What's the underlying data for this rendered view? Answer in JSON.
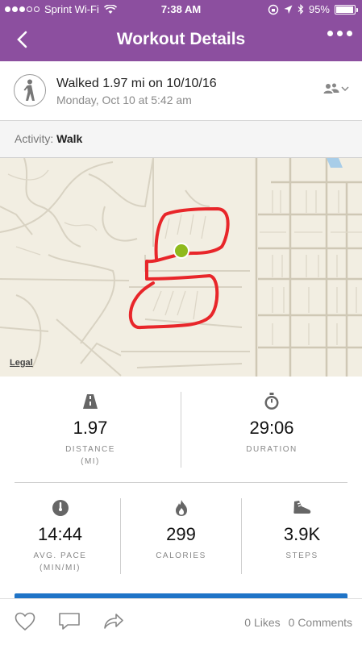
{
  "status_bar": {
    "carrier": "Sprint Wi-Fi",
    "time": "7:38 AM",
    "battery": "95%",
    "battery_level": 0.95
  },
  "nav": {
    "title": "Workout Details"
  },
  "workout": {
    "title": "Walked 1.97 mi on 10/10/16",
    "subtitle": "Monday, Oct 10 at 5:42 am"
  },
  "activity": {
    "label": "Activity:",
    "value": "Walk"
  },
  "map": {
    "legal": "Legal"
  },
  "stats": {
    "distance": {
      "value": "1.97",
      "label_line1": "DISTANCE",
      "label_line2": "(MI)"
    },
    "duration": {
      "value": "29:06",
      "label_line1": "DURATION"
    },
    "pace": {
      "value": "14:44",
      "label_line1": "AVG. PACE",
      "label_line2": "(MIN/MI)"
    },
    "calories": {
      "value": "299",
      "label_line1": "CALORIES"
    },
    "steps": {
      "value": "3.9K",
      "label_line1": "STEPS"
    }
  },
  "footer": {
    "likes": "0 Likes",
    "comments": "0 Comments"
  },
  "colors": {
    "brand": "#8c4f9f",
    "route": "#e8262a",
    "marker": "#8fba1d",
    "accent": "#1f74c7"
  },
  "icons": {
    "back": "chevron-left-icon",
    "more": "more-dots-icon",
    "walk": "walking-person-icon",
    "privacy": "friends-privacy-icon",
    "distance": "road-icon",
    "duration": "stopwatch-icon",
    "pace": "speedometer-icon",
    "calories": "flame-icon",
    "steps": "shoe-icon",
    "like": "heart-icon",
    "comment": "comment-icon",
    "share": "share-icon"
  }
}
